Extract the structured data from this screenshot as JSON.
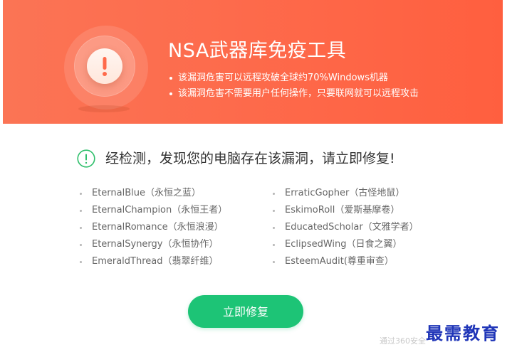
{
  "banner": {
    "title": "NSA武器库免疫工具",
    "points": [
      "该漏洞危害可以远程攻破全球约70%Windows机器",
      "该漏洞危害不需要用户任何操作，只要联网就可以远程攻击"
    ],
    "icon": "exclamation-alert-icon",
    "colors": {
      "background": "#fd6b4c",
      "icon_core": "#fff1ea",
      "icon_mark": "#ff6a4b"
    }
  },
  "detection": {
    "icon": "exclamation-circle-icon",
    "message": "经检测，发现您的电脑存在该漏洞，请立即修复!",
    "color": "#2fbf6b"
  },
  "vulnerabilities": {
    "left": [
      "EternalBlue（永恒之蓝）",
      "EternalChampion（永恒王者）",
      "EternalRomance（永恒浪漫）",
      "EternalSynergy（永恒协作）",
      "EmeraldThread（翡翠纤维）"
    ],
    "right": [
      "ErraticGopher（古怪地鼠）",
      "EskimoRoll（爱斯基摩卷）",
      "EducatedScholar（文雅学者）",
      "EclipsedWing（日食之翼）",
      "EsteemAudit(尊重审查）"
    ]
  },
  "actions": {
    "fix_label": "立即修复",
    "accent": "#1dc476"
  },
  "footer": {
    "note": "通过360安全"
  },
  "watermark": {
    "text": "最需教育"
  }
}
